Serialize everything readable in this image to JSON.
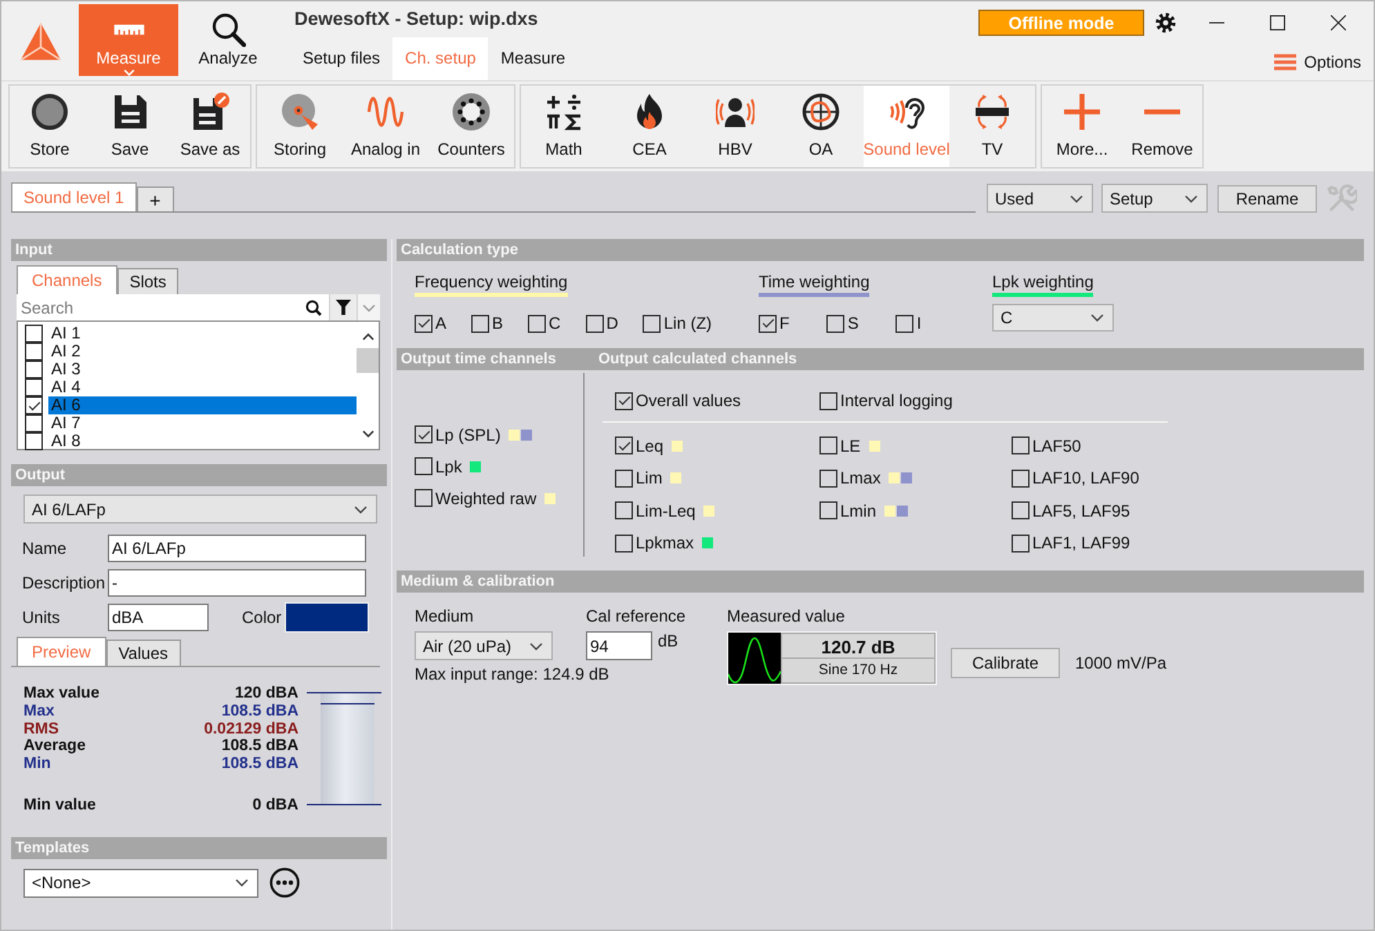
{
  "app": {
    "title": "DewesoftX - Setup: wip.dxs",
    "offline_button": "Offline mode",
    "options": "Options"
  },
  "modes": [
    {
      "label": "Measure",
      "selected": true
    },
    {
      "label": "Analyze",
      "selected": false
    }
  ],
  "subtabs": [
    {
      "label": "Setup files",
      "selected": false
    },
    {
      "label": "Ch. setup",
      "selected": true
    },
    {
      "label": "Measure",
      "selected": false
    }
  ],
  "toolbar": [
    {
      "buttons": [
        {
          "label": "Store",
          "selected": false
        },
        {
          "label": "Save",
          "selected": false
        },
        {
          "label": "Save as",
          "selected": false
        }
      ]
    },
    {
      "buttons": [
        {
          "label": "Storing",
          "selected": false
        },
        {
          "label": "Analog in",
          "selected": false
        },
        {
          "label": "Counters",
          "selected": false
        }
      ]
    },
    {
      "buttons": [
        {
          "label": "Math",
          "selected": false
        },
        {
          "label": "CEA",
          "selected": false
        },
        {
          "label": "HBV",
          "selected": false
        },
        {
          "label": "OA",
          "selected": false
        },
        {
          "label": "Sound level",
          "selected": true
        },
        {
          "label": "TV",
          "selected": false
        }
      ]
    },
    {
      "buttons": [
        {
          "label": "More...",
          "selected": false
        },
        {
          "label": "Remove",
          "selected": false
        }
      ]
    }
  ],
  "channel_tabs": {
    "tabs": [
      {
        "label": "Sound level 1",
        "selected": true
      }
    ],
    "add": "+",
    "filters": [
      "Used",
      "Setup"
    ],
    "rename": "Rename"
  },
  "input": {
    "title": "Input",
    "tabs": [
      {
        "label": "Channels",
        "selected": true
      },
      {
        "label": "Slots",
        "selected": false
      }
    ],
    "search": {
      "placeholder": "Search"
    },
    "channels": [
      {
        "name": "AI 1",
        "checked": false,
        "selected": false
      },
      {
        "name": "AI 2",
        "checked": false,
        "selected": false
      },
      {
        "name": "AI 3",
        "checked": false,
        "selected": false
      },
      {
        "name": "AI 4",
        "checked": false,
        "selected": false
      },
      {
        "name": "AI 6",
        "checked": true,
        "selected": true
      },
      {
        "name": "AI 7",
        "checked": false,
        "selected": false
      },
      {
        "name": "AI 8",
        "checked": false,
        "selected": false
      }
    ]
  },
  "output": {
    "title": "Output",
    "channel": "AI 6/LAFp",
    "fields": [
      {
        "label": "Name",
        "value": "AI 6/LAFp"
      },
      {
        "label": "Description",
        "value": "-"
      }
    ],
    "units_label": "Units",
    "units": "dBA",
    "color_label": "Color",
    "color": "#002a80"
  },
  "preview": {
    "tabs": [
      {
        "label": "Preview",
        "selected": true
      },
      {
        "label": "Values",
        "selected": false
      }
    ],
    "max_value": {
      "label": "Max value",
      "value": "120 dBA"
    },
    "readings": [
      {
        "label": "Max",
        "value": "108.5 dBA",
        "color": "#23318c"
      },
      {
        "label": "RMS",
        "value": "0.02129 dBA",
        "color": "#8a1c1c"
      },
      {
        "label": "Average",
        "value": "108.5 dBA",
        "color": "#111111"
      },
      {
        "label": "Min",
        "value": "108.5 dBA",
        "color": "#23318c"
      }
    ],
    "min_value": {
      "label": "Min value",
      "value": "0 dBA"
    },
    "meter": {
      "level": 0.9
    }
  },
  "templates": {
    "title": "Templates",
    "value": "<None>"
  },
  "calculation_type": {
    "title": "Calculation type",
    "weightings": [
      {
        "title": "Frequency weighting",
        "color": "#fff8a8",
        "kind": "checks",
        "options": [
          {
            "label": "A",
            "checked": true
          },
          {
            "label": "B",
            "checked": false
          },
          {
            "label": "C",
            "checked": false
          },
          {
            "label": "D",
            "checked": false
          },
          {
            "label": "Lin (Z)",
            "checked": false
          }
        ]
      },
      {
        "title": "Time weighting",
        "color": "#8f93cc",
        "kind": "checks",
        "options": [
          {
            "label": "F",
            "checked": true
          },
          {
            "label": "S",
            "checked": false
          },
          {
            "label": "I",
            "checked": false
          }
        ]
      },
      {
        "title": "Lpk weighting",
        "color": "#12e87c",
        "kind": "select",
        "value": "C"
      }
    ]
  },
  "output_time_channels": {
    "title": "Output time channels",
    "items": [
      {
        "label": "Lp (SPL)",
        "checked": true,
        "swatches": [
          {
            "color": "#fff8b4"
          },
          {
            "color": "#8f93cc"
          }
        ]
      },
      {
        "label": "Lpk",
        "checked": false,
        "swatches": [
          {
            "color": "#12e87c"
          }
        ]
      },
      {
        "label": "Weighted raw",
        "checked": false,
        "swatches": [
          {
            "color": "#fff8b4"
          }
        ]
      }
    ]
  },
  "output_calculated_channels": {
    "title": "Output calculated channels",
    "modes": [
      {
        "label": "Overall values",
        "checked": true
      },
      {
        "label": "Interval logging",
        "checked": false
      }
    ],
    "columns": [
      [
        {
          "label": "Leq",
          "checked": true,
          "swatches": [
            {
              "color": "#fff8b4"
            }
          ]
        },
        {
          "label": "Lim",
          "checked": false,
          "swatches": [
            {
              "color": "#fff8b4"
            }
          ]
        },
        {
          "label": "Lim-Leq",
          "checked": false,
          "swatches": [
            {
              "color": "#fff8b4"
            }
          ]
        },
        {
          "label": "Lpkmax",
          "checked": false,
          "swatches": [
            {
              "color": "#12e87c"
            }
          ]
        }
      ],
      [
        {
          "label": "LE",
          "checked": false,
          "swatches": [
            {
              "color": "#fff8b4"
            }
          ]
        },
        {
          "label": "Lmax",
          "checked": false,
          "swatches": [
            {
              "color": "#fff8b4"
            },
            {
              "color": "#8f93cc"
            }
          ]
        },
        {
          "label": "Lmin",
          "checked": false,
          "swatches": [
            {
              "color": "#fff8b4"
            },
            {
              "color": "#8f93cc"
            }
          ]
        }
      ],
      [
        {
          "label": "LAF50",
          "checked": false
        },
        {
          "label": "LAF10, LAF90",
          "checked": false
        },
        {
          "label": "LAF5, LAF95",
          "checked": false
        },
        {
          "label": "LAF1, LAF99",
          "checked": false
        }
      ]
    ]
  },
  "medium_calibration": {
    "title": "Medium & calibration",
    "medium": {
      "label": "Medium",
      "value": "Air (20 uPa)",
      "note": "Max input range: 124.9 dB"
    },
    "cal_reference": {
      "label": "Cal reference",
      "value": "94",
      "unit": "dB"
    },
    "measured": {
      "label": "Measured value",
      "value": "120.7 dB",
      "signal": "Sine 170 Hz"
    },
    "calibrate": "Calibrate",
    "sensitivity": "1000 mV/Pa"
  }
}
